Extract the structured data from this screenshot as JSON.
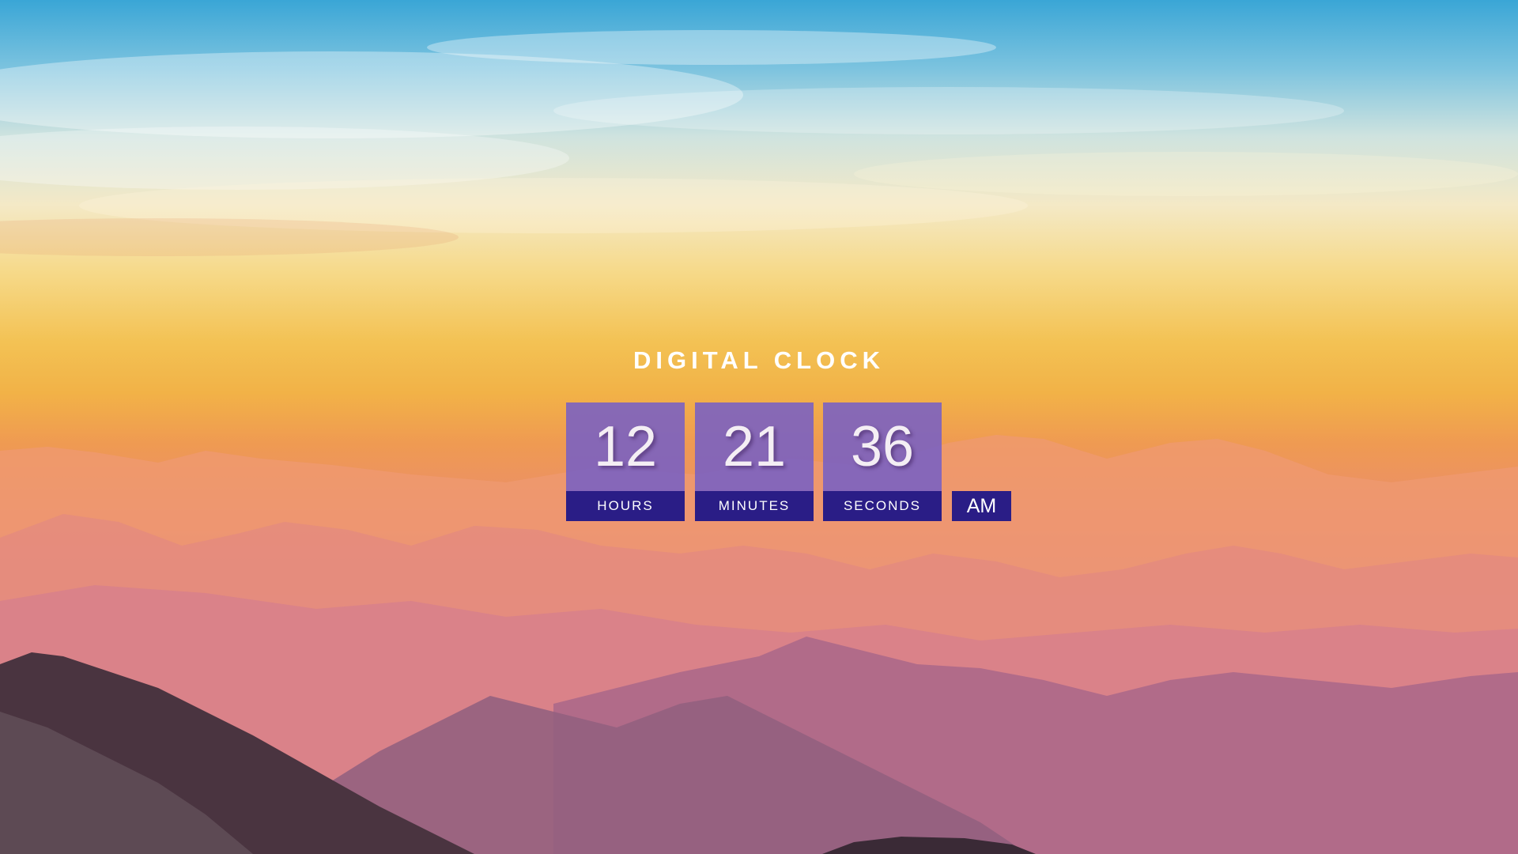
{
  "clock": {
    "title": "DIGITAL CLOCK",
    "hours": {
      "value": "12",
      "label": "HOURS"
    },
    "minutes": {
      "value": "21",
      "label": "MINUTES"
    },
    "seconds": {
      "value": "36",
      "label": "SECONDS"
    },
    "period": "AM"
  },
  "colors": {
    "digit_box": "#7860c4",
    "label_box": "#2a1d86",
    "text": "#ffffff"
  }
}
